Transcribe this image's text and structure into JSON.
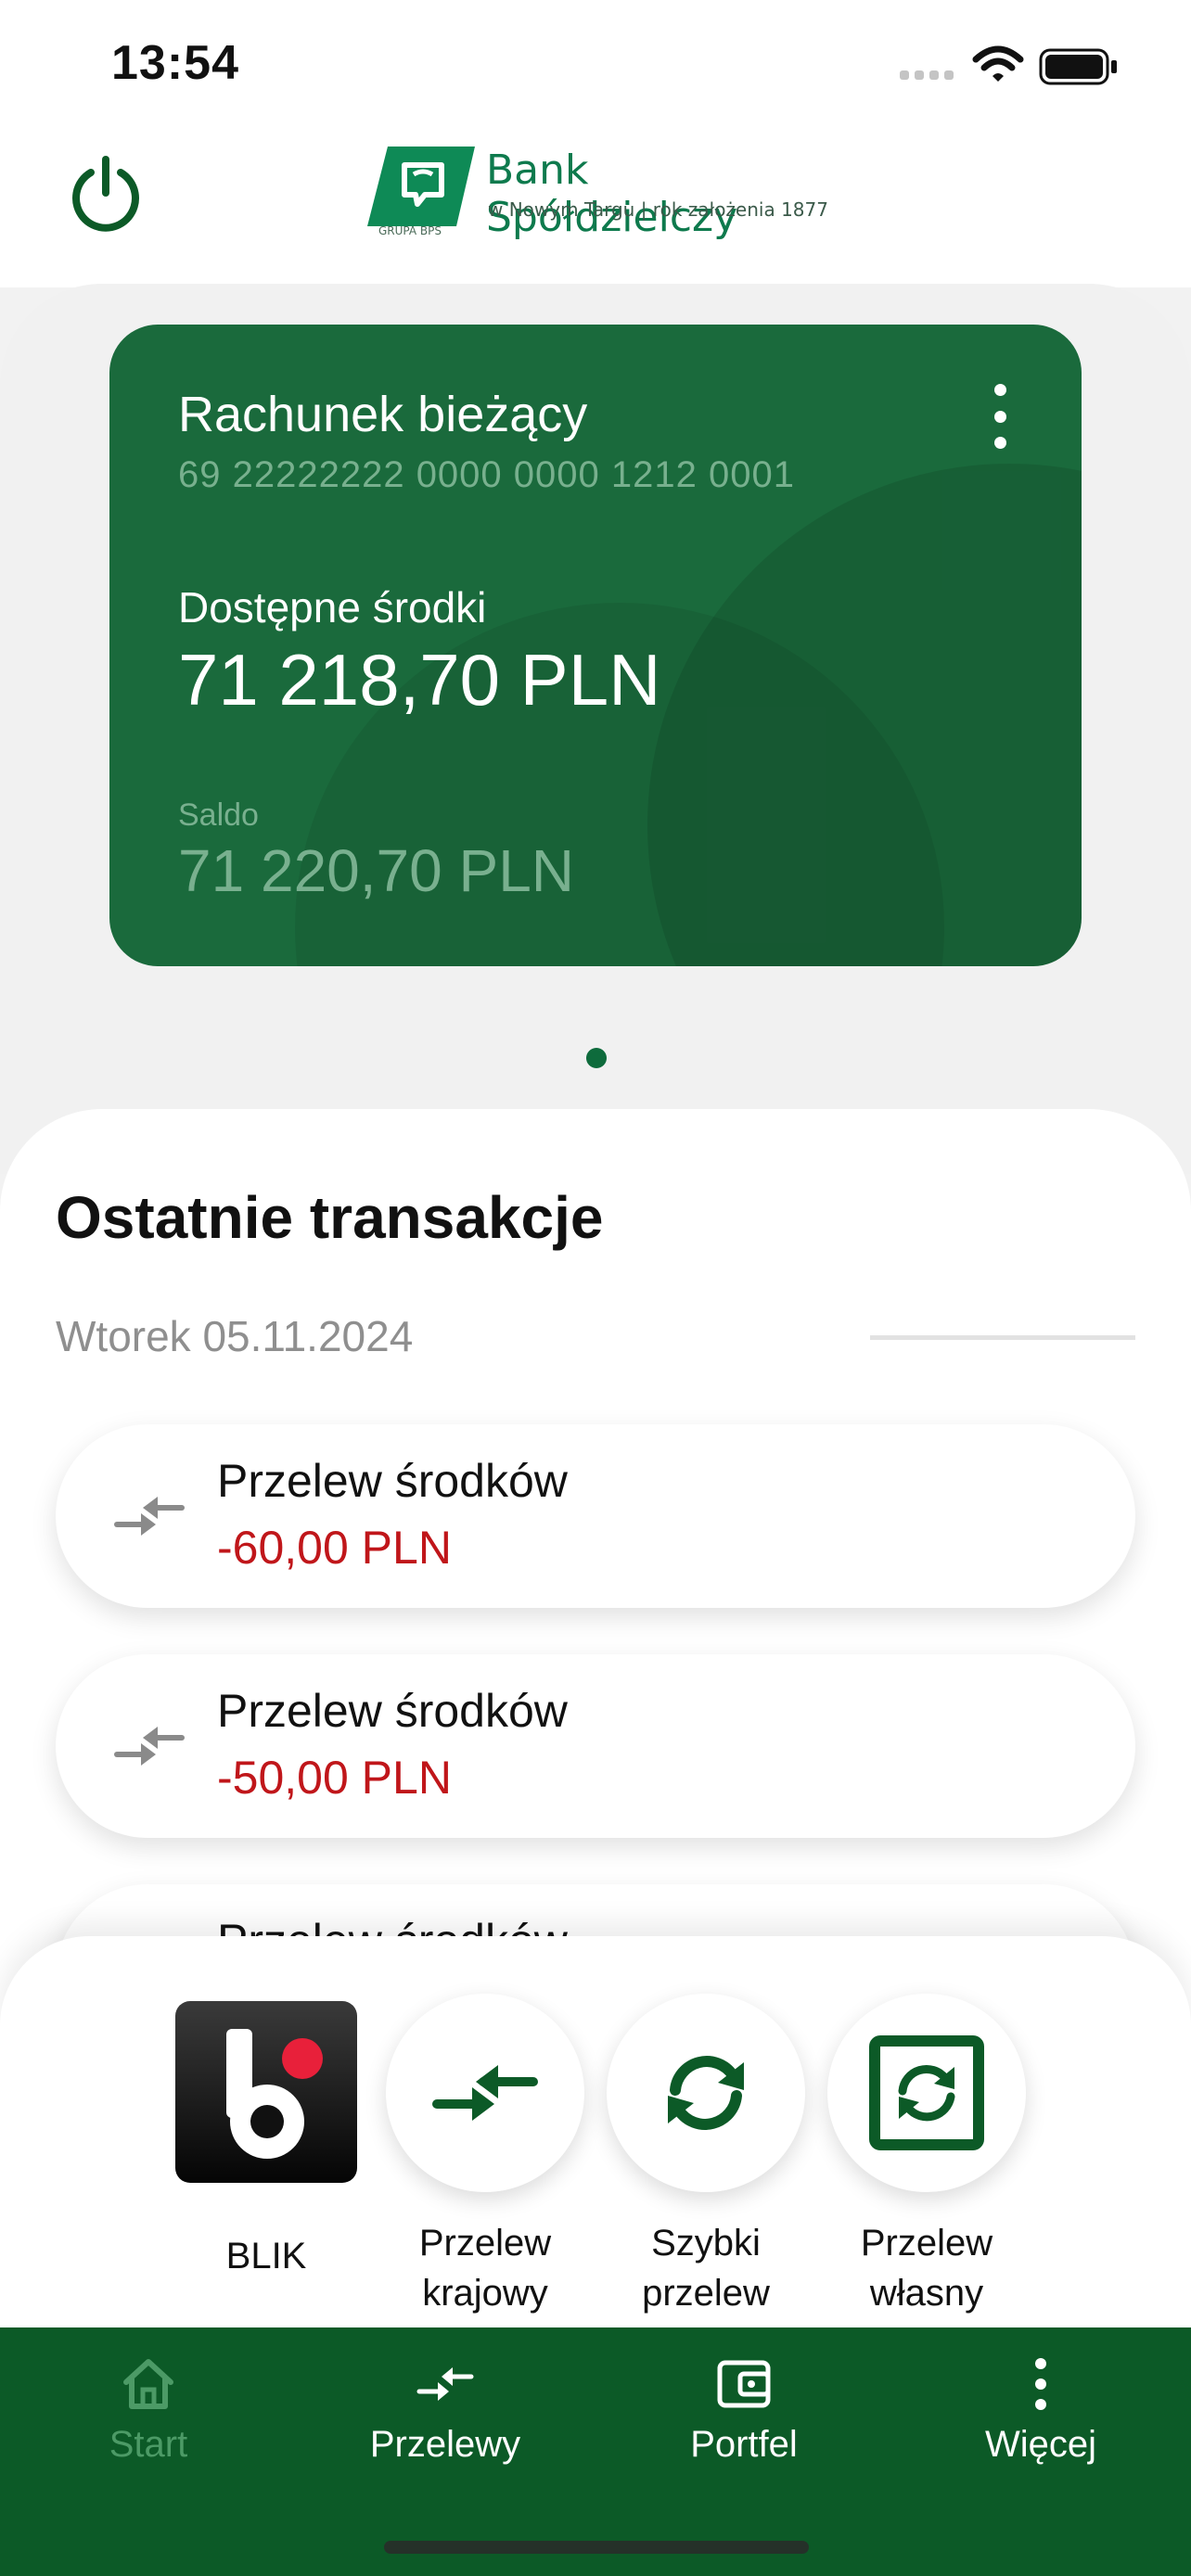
{
  "status_bar": {
    "time": "13:54"
  },
  "header": {
    "logo": {
      "name": "Bank Spółdzielczy",
      "tagline": "w Nowym Targu | rok założenia 1877",
      "group": "GRUPA BPS"
    }
  },
  "account_card": {
    "name": "Rachunek bieżący",
    "number": "69 22222222 0000 0000 1212 0001",
    "available_label": "Dostępne środki",
    "available_amount": "71 218,70 PLN",
    "balance_label": "Saldo",
    "balance_amount": "71 220,70 PLN"
  },
  "transactions": {
    "title": "Ostatnie transakcje",
    "date": "Wtorek 05.11.2024",
    "items": [
      {
        "title": "Przelew środków",
        "amount": "-60,00 PLN"
      },
      {
        "title": "Przelew środków",
        "amount": "-50,00 PLN"
      },
      {
        "title": "Przelew środków",
        "amount": ""
      }
    ]
  },
  "quick_actions": [
    {
      "label": "BLIK"
    },
    {
      "label": "Przelew krajowy"
    },
    {
      "label": "Szybki przelew"
    },
    {
      "label": "Przelew własny"
    }
  ],
  "bottom_nav": [
    {
      "label": "Start"
    },
    {
      "label": "Przelewy"
    },
    {
      "label": "Portfel"
    },
    {
      "label": "Więcej"
    }
  ],
  "colors": {
    "brand_green": "#0c5a27",
    "card_green": "#1a6a3c",
    "negative_amount": "#c0161a",
    "active_nav": "#4c9a66"
  }
}
